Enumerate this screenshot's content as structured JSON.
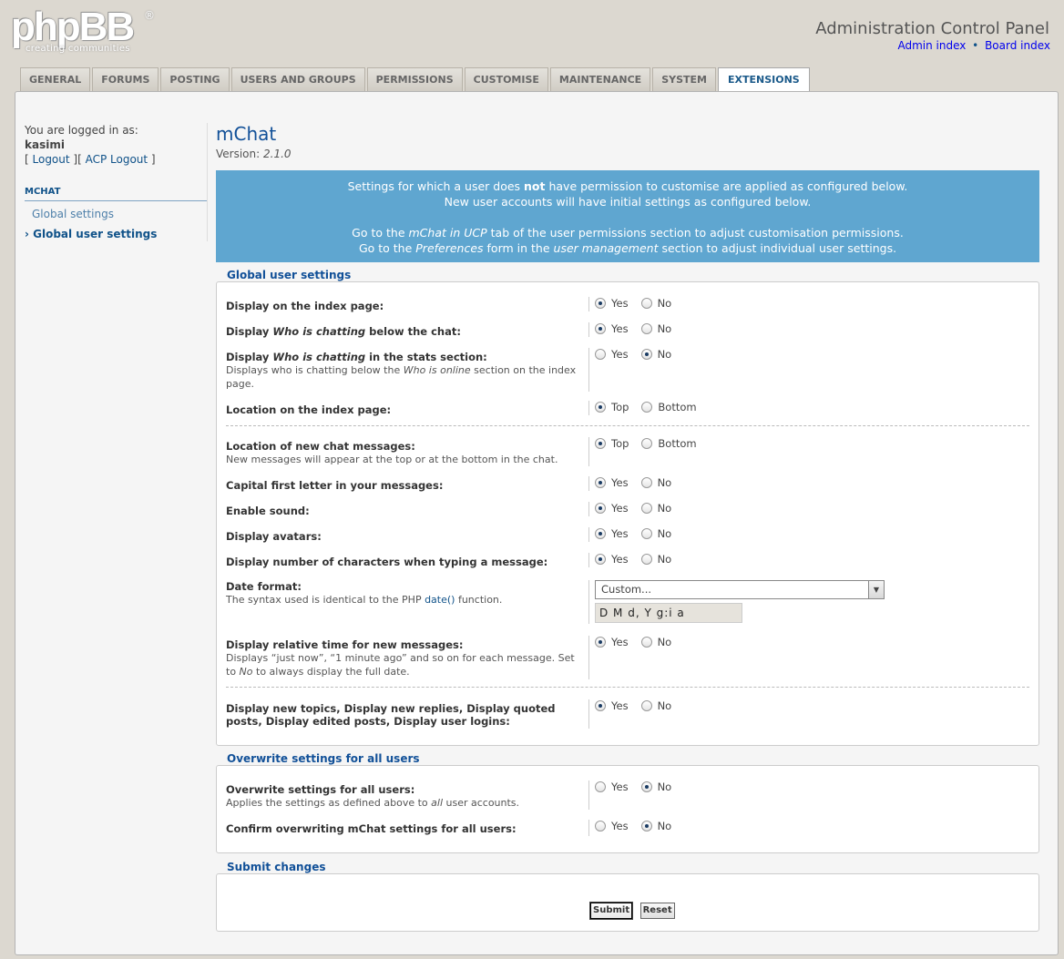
{
  "logo": {
    "word": "phpBB",
    "tagline": "creating communities",
    "reg": "®"
  },
  "header": {
    "title": "Administration Control Panel",
    "admin_index": "Admin index",
    "sep": "•",
    "board_index": "Board index"
  },
  "tabs": [
    "GENERAL",
    "FORUMS",
    "POSTING",
    "USERS AND GROUPS",
    "PERMISSIONS",
    "CUSTOMISE",
    "MAINTENANCE",
    "SYSTEM",
    "EXTENSIONS"
  ],
  "sidebar": {
    "logged_in_as": "You are logged in as:",
    "username": "kasimi",
    "logout_open": "[ ",
    "logout": "Logout",
    "mid": " ][ ",
    "acp_logout": "ACP Logout",
    "logout_close": " ]",
    "section": "MCHAT",
    "items": [
      {
        "label": "Global settings"
      },
      {
        "label": "Global user settings"
      }
    ]
  },
  "main": {
    "title": "mChat",
    "version_label": "Version:",
    "version": "2.1.0",
    "info": {
      "l1a": "Settings for which a user does ",
      "l1b": "not",
      "l1c": " have permission to customise are applied as configured below.",
      "l2": "New user accounts will have initial settings as configured below.",
      "l3a": "Go to the ",
      "l3b": "mChat in UCP",
      "l3c": " tab of the user permissions section to adjust customisation permissions.",
      "l4a": "Go to the ",
      "l4b": "Preferences",
      "l4c": " form in the ",
      "l4d": "user management",
      "l4e": " section to adjust individual user settings."
    }
  },
  "global": {
    "legend": "Global user settings",
    "rows": [
      {
        "label": "Display on the index page:",
        "a": "Yes",
        "b": "No",
        "sel": "a"
      },
      {
        "label_a": "Display ",
        "label_i": "Who is chatting",
        "label_b": " below the chat:",
        "a": "Yes",
        "b": "No",
        "sel": "a"
      },
      {
        "label_a": "Display ",
        "label_i": "Who is chatting",
        "label_b": " in the stats section:",
        "desc_a": "Displays who is chatting below the ",
        "desc_i": "Who is online",
        "desc_b": " section on the index page.",
        "a": "Yes",
        "b": "No",
        "sel": "b"
      },
      {
        "label": "Location on the index page:",
        "a": "Top",
        "b": "Bottom",
        "sel": "a"
      },
      {
        "label": "Location of new chat messages:",
        "desc": "New messages will appear at the top or at the bottom in the chat.",
        "a": "Top",
        "b": "Bottom",
        "sel": "a"
      },
      {
        "label": "Capital first letter in your messages:",
        "a": "Yes",
        "b": "No",
        "sel": "a"
      },
      {
        "label": "Enable sound:",
        "a": "Yes",
        "b": "No",
        "sel": "a"
      },
      {
        "label": "Display avatars:",
        "a": "Yes",
        "b": "No",
        "sel": "a"
      },
      {
        "label": "Display number of characters when typing a message:",
        "a": "Yes",
        "b": "No",
        "sel": "a"
      },
      {
        "label": "Date format:",
        "desc_a": "The syntax used is identical to the PHP ",
        "desc_link": "date()",
        "desc_b": " function.",
        "select": "Custom...",
        "value": "D M d, Y g:i a"
      },
      {
        "label": "Display relative time for new messages:",
        "desc_a": "Displays “just now”, “1 minute ago” and so on for each message. Set to ",
        "desc_i": "No",
        "desc_b": " to always display the full date.",
        "a": "Yes",
        "b": "No",
        "sel": "a"
      },
      {
        "label": "Display new topics, Display new replies, Display quoted posts, Display edited posts, Display user logins:",
        "a": "Yes",
        "b": "No",
        "sel": "a"
      }
    ]
  },
  "overwrite": {
    "legend": "Overwrite settings for all users",
    "rows": [
      {
        "label": "Overwrite settings for all users:",
        "desc_a": "Applies the settings as defined above to ",
        "desc_i": "all",
        "desc_b": " user accounts.",
        "a": "Yes",
        "b": "No",
        "sel": "b"
      },
      {
        "label": "Confirm overwriting mChat settings for all users:",
        "a": "Yes",
        "b": "No",
        "sel": "b"
      }
    ]
  },
  "submit": {
    "legend": "Submit changes",
    "submit": "Submit",
    "reset": "Reset"
  }
}
